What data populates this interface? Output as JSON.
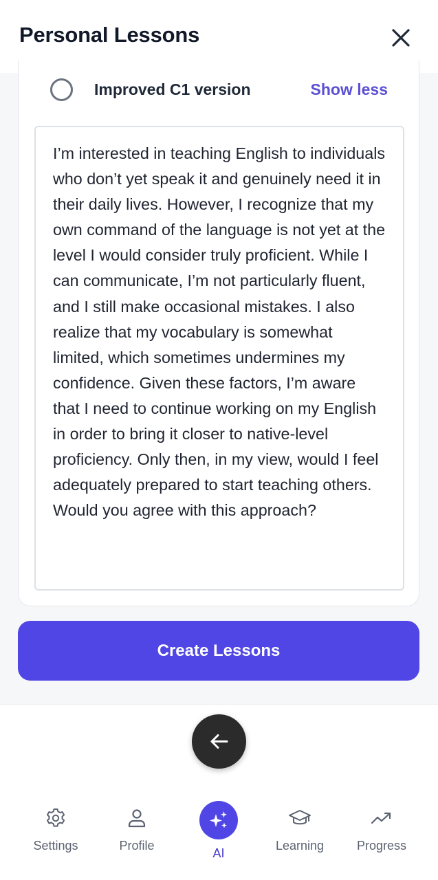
{
  "header": {
    "title": "Personal Lessons"
  },
  "option": {
    "label": "Improved C1 version",
    "toggle_label": "Show less",
    "selected": false
  },
  "text": {
    "body": "I’m interested in teaching English to individuals who don’t yet speak it and genuinely need it in their daily lives. However, I recognize that my own command of the language is not yet at the level I would consider truly proficient. While I can communicate, I’m not particularly fluent, and I still make occasional mistakes. I also realize that my vocabulary is somewhat limited, which sometimes undermines my confidence. Given these factors, I’m aware that I need to continue working on my English in order to bring it closer to native-level proficiency. Only then, in my view, would I feel adequately prepared to start teaching others. Would you agree with this approach?"
  },
  "actions": {
    "create_label": "Create Lessons"
  },
  "nav": {
    "items": [
      {
        "label": "Settings",
        "icon": "gear-icon"
      },
      {
        "label": "Profile",
        "icon": "person-icon"
      },
      {
        "label": "AI",
        "icon": "sparkles-icon"
      },
      {
        "label": "Learning",
        "icon": "graduation-cap-icon"
      },
      {
        "label": "Progress",
        "icon": "trending-up-icon"
      }
    ],
    "active": "AI"
  },
  "colors": {
    "accent": "#5046e5",
    "link": "#5b4fd4",
    "fab": "#2b2b2b"
  }
}
